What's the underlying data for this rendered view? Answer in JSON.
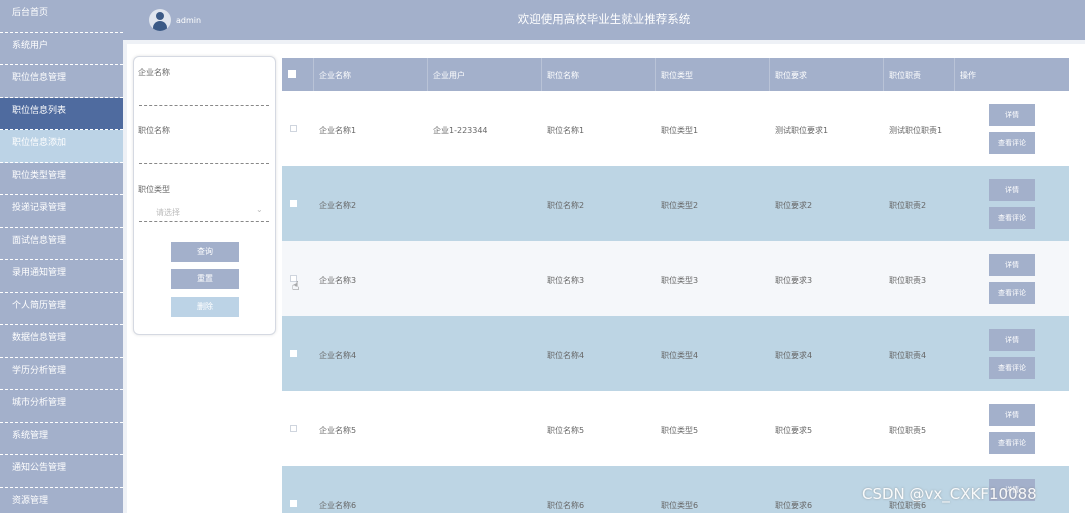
{
  "sidebar": {
    "items": [
      {
        "label": "后台首页"
      },
      {
        "label": "系统用户"
      },
      {
        "label": "职位信息管理"
      },
      {
        "label": "职位信息列表"
      },
      {
        "label": "职位信息添加"
      },
      {
        "label": "职位类型管理"
      },
      {
        "label": "投递记录管理"
      },
      {
        "label": "面试信息管理"
      },
      {
        "label": "录用通知管理"
      },
      {
        "label": "个人简历管理"
      },
      {
        "label": "数据信息管理"
      },
      {
        "label": "学历分析管理"
      },
      {
        "label": "城市分析管理"
      },
      {
        "label": "系统管理"
      },
      {
        "label": "通知公告管理"
      },
      {
        "label": "资源管理"
      }
    ]
  },
  "header": {
    "user": "admin",
    "title": "欢迎使用高校毕业生就业推荐系统"
  },
  "search": {
    "company_label": "企业名称",
    "position_label": "职位名称",
    "type_label": "职位类型",
    "type_placeholder": "请选择",
    "query_button": "查询",
    "reset_button": "重置",
    "delete_button": "删除"
  },
  "table": {
    "headers": [
      "企业名称",
      "企业用户",
      "职位名称",
      "职位类型",
      "职位要求",
      "职位职责",
      "操作"
    ],
    "detail_label": "详情",
    "review_label": "查看评论",
    "rows": [
      {
        "company": "企业名称1",
        "user": "企业1-223344",
        "position": "职位名称1",
        "type": "职位类型1",
        "req": "测试职位要求1",
        "duty": "测试职位职责1"
      },
      {
        "company": "企业名称2",
        "user": "",
        "position": "职位名称2",
        "type": "职位类型2",
        "req": "职位要求2",
        "duty": "职位职责2"
      },
      {
        "company": "企业名称3",
        "user": "",
        "position": "职位名称3",
        "type": "职位类型3",
        "req": "职位要求3",
        "duty": "职位职责3"
      },
      {
        "company": "企业名称4",
        "user": "",
        "position": "职位名称4",
        "type": "职位类型4",
        "req": "职位要求4",
        "duty": "职位职责4"
      },
      {
        "company": "企业名称5",
        "user": "",
        "position": "职位名称5",
        "type": "职位类型5",
        "req": "职位要求5",
        "duty": "职位职责5"
      },
      {
        "company": "企业名称6",
        "user": "",
        "position": "职位名称6",
        "type": "职位类型6",
        "req": "职位要求6",
        "duty": "职位职责6"
      }
    ]
  },
  "watermark": "CSDN @vx_CXKF10088",
  "colors": {
    "sidebar": "#a3b0cb",
    "active": "#4f6b9f",
    "row_alt": "#bdd5e4"
  }
}
